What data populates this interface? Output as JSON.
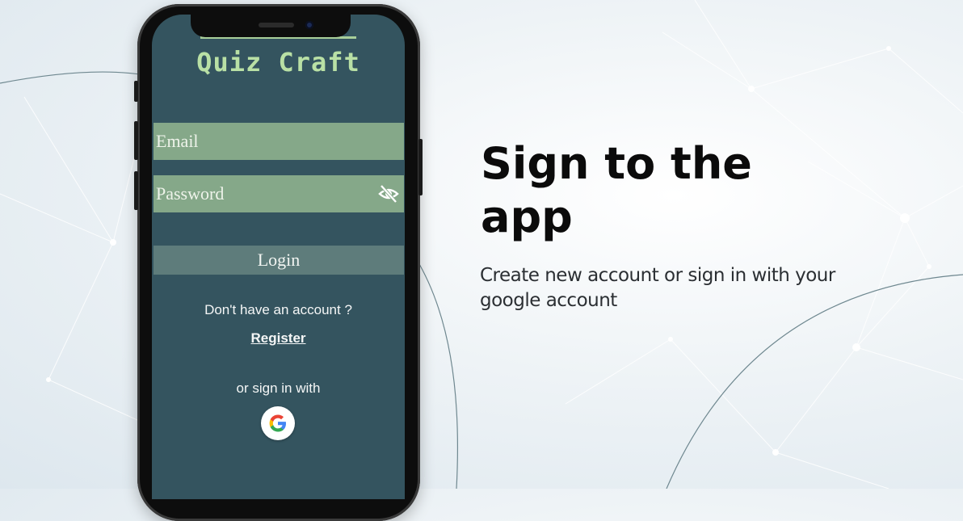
{
  "app": {
    "title": "Quiz Craft",
    "email_placeholder": "Email",
    "password_placeholder": "Password",
    "login_label": "Login",
    "no_account_text": "Don't have an account ?",
    "register_label": "Register",
    "or_sign_in_text": "or sign in with"
  },
  "hero": {
    "headline": "Sign to the app",
    "subtext": "Create new account or sign in with your google account"
  },
  "icons": {
    "password_toggle": "eye-slash-icon",
    "google": "google-logo-icon"
  },
  "colors": {
    "screen_bg": "#34545f",
    "field_bg": "#85a889",
    "login_bg": "#5e7c7b",
    "title_green": "#b9e0a5"
  }
}
